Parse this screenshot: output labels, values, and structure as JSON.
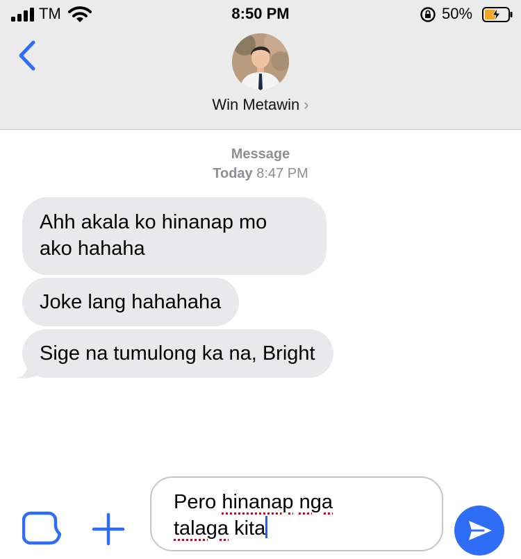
{
  "status_bar": {
    "carrier": "TM",
    "time": "8:50 PM",
    "battery_percent": "50%",
    "battery_level": 0.5,
    "charging": true
  },
  "header": {
    "contact_name": "Win Metawin",
    "chevron": "›"
  },
  "thread": {
    "service": "Message",
    "day": "Today",
    "time": "8:47 PM",
    "messages": [
      {
        "line1": "Ahh akala ko hinanap mo",
        "line2": "ako hahaha"
      },
      {
        "line1": "Joke lang hahahaha"
      },
      {
        "line1": "Sige na tumulong ka na, Bright"
      }
    ]
  },
  "composer": {
    "text_words": [
      "Pero",
      "hinanap",
      "nga",
      "talaga",
      "kita"
    ]
  },
  "colors": {
    "accent": "#2f6df6",
    "bubble": "#e9e9eb",
    "header": "#ebebeb",
    "meta": "#8e8e93",
    "spellcheck": "#d0021b",
    "charging": "#f5a623"
  }
}
